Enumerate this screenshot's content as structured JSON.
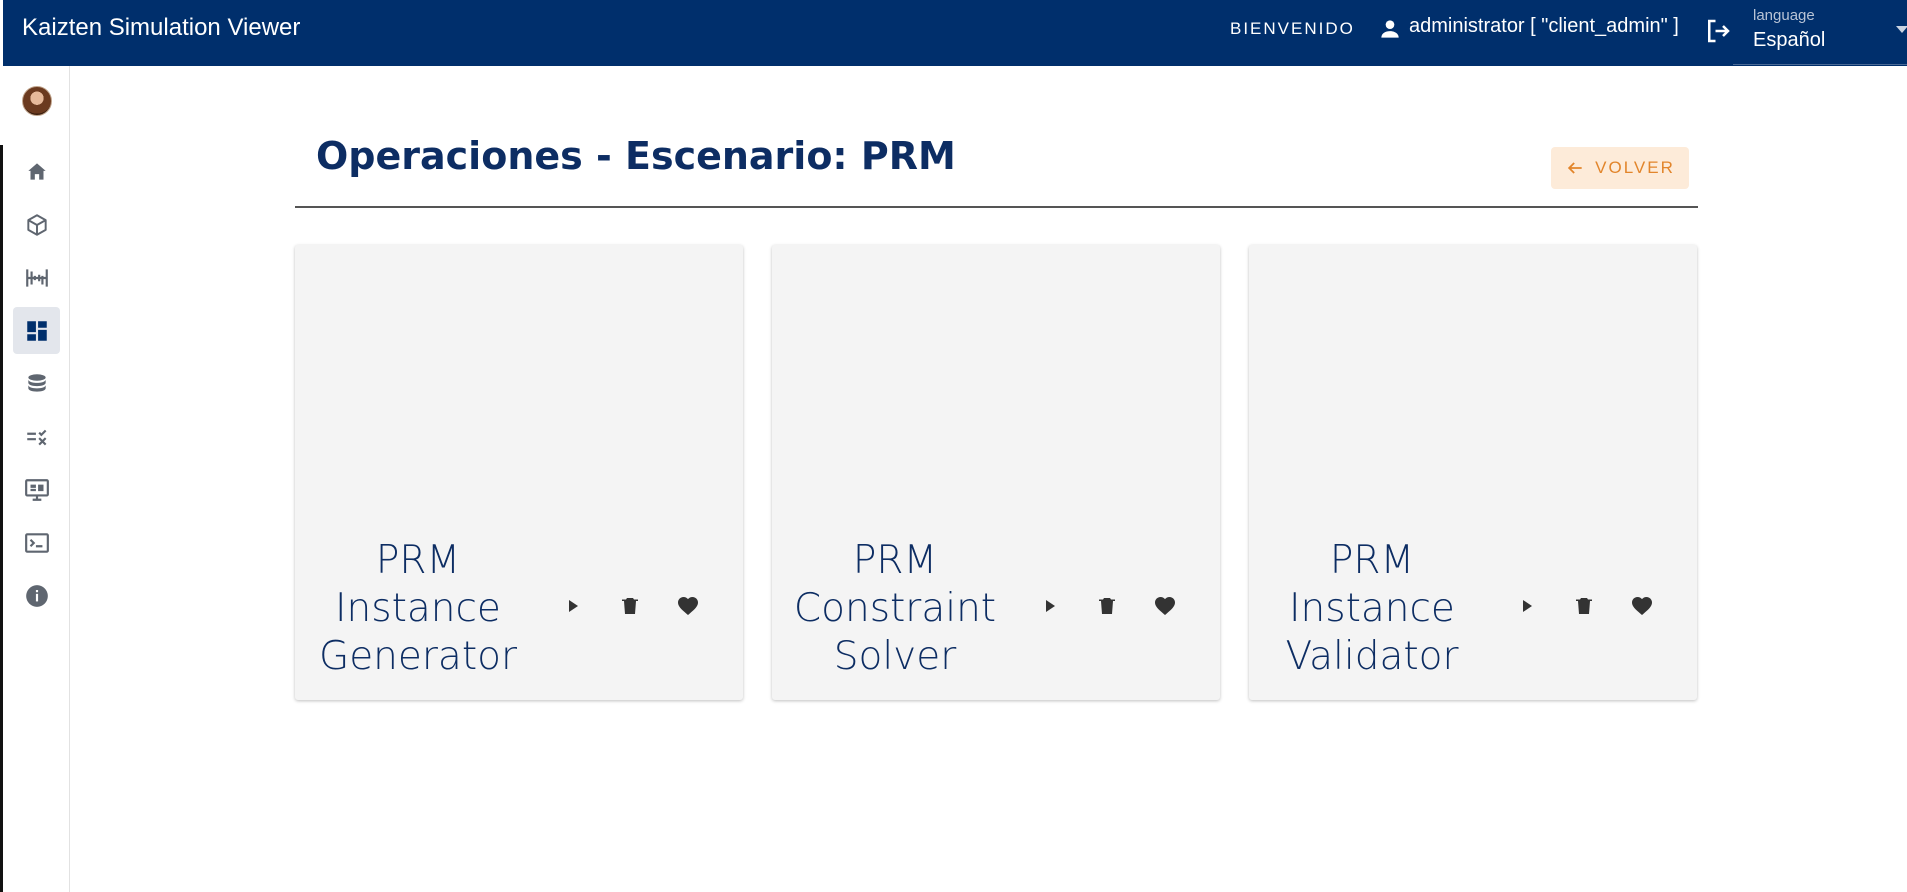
{
  "app": {
    "title": "Kaizten Simulation Viewer"
  },
  "header": {
    "welcome": "BIENVENIDO",
    "user": "administrator [ \"client_admin\" ]",
    "language_label": "language",
    "language_value": "Español"
  },
  "sidebar": {
    "items": [
      {
        "icon": "home-icon"
      },
      {
        "icon": "cube-icon"
      },
      {
        "icon": "timeline-icon"
      },
      {
        "icon": "dashboard-icon",
        "active": true
      },
      {
        "icon": "database-icon"
      },
      {
        "icon": "checklist-icon"
      },
      {
        "icon": "monitor-icon"
      },
      {
        "icon": "terminal-icon"
      },
      {
        "icon": "info-icon"
      }
    ]
  },
  "main": {
    "title": "Operaciones - Escenario: PRM",
    "back_label": "VOLVER",
    "cards": [
      {
        "title": "PRM Instance Generator"
      },
      {
        "title": "PRM Constraint Solver"
      },
      {
        "title": "PRM Instance Validator"
      }
    ]
  },
  "colors": {
    "header_bg": "#002f6c",
    "title_text": "#0d2d63",
    "back_button_bg": "#fdebd9",
    "back_button_text": "#e2852b",
    "card_bg": "#f4f4f4"
  }
}
